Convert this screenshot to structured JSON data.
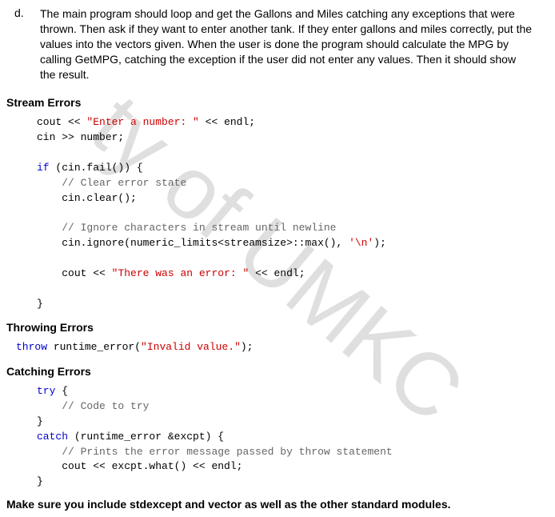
{
  "item": {
    "letter": "d.",
    "text": "The main program should loop and get the Gallons and Miles catching any exceptions that were thrown. Then ask if they want to enter another tank. If they enter gallons and miles correctly, put the values into the vectors given. When the user is done the program should calculate the MPG by calling GetMPG, catching the exception if the user did not enter any values. Then it should show the result."
  },
  "sections": {
    "stream_errors": {
      "title": "Stream Errors",
      "code": {
        "l1a": "cout << ",
        "l1b": "\"Enter a number: \"",
        "l1c": " << endl;",
        "l2": "cin >> number;",
        "l3a": "if",
        "l3b": " (cin.fail()) {",
        "l4": "// Clear error state",
        "l5": "cin.clear();",
        "l6": "// Ignore characters in stream until newline",
        "l7a": "cin.ignore(numeric_limits<streamsize>::max(), ",
        "l7b": "'\\n'",
        "l7c": ");",
        "l8a": "cout << ",
        "l8b": "\"There was an error: \"",
        "l8c": " << endl;",
        "l9": "}"
      }
    },
    "throwing_errors": {
      "title": "Throwing Errors",
      "code": {
        "l1a": "throw",
        "l1b": " runtime_error(",
        "l1c": "\"Invalid value.\"",
        "l1d": ");"
      }
    },
    "catching_errors": {
      "title": "Catching Errors",
      "code": {
        "l1a": "try",
        "l1b": " {",
        "l2": "// Code to try",
        "l3": "}",
        "l4a": "catch",
        "l4b": " (runtime_error &excpt) {",
        "l5": "// Prints the error message passed by throw statement",
        "l6": "cout << excpt.what() << endl;",
        "l7": "}"
      }
    }
  },
  "footer": "Make sure you include stdexcept and vector as well as the other standard modules.",
  "watermark": "ty of UMKC"
}
